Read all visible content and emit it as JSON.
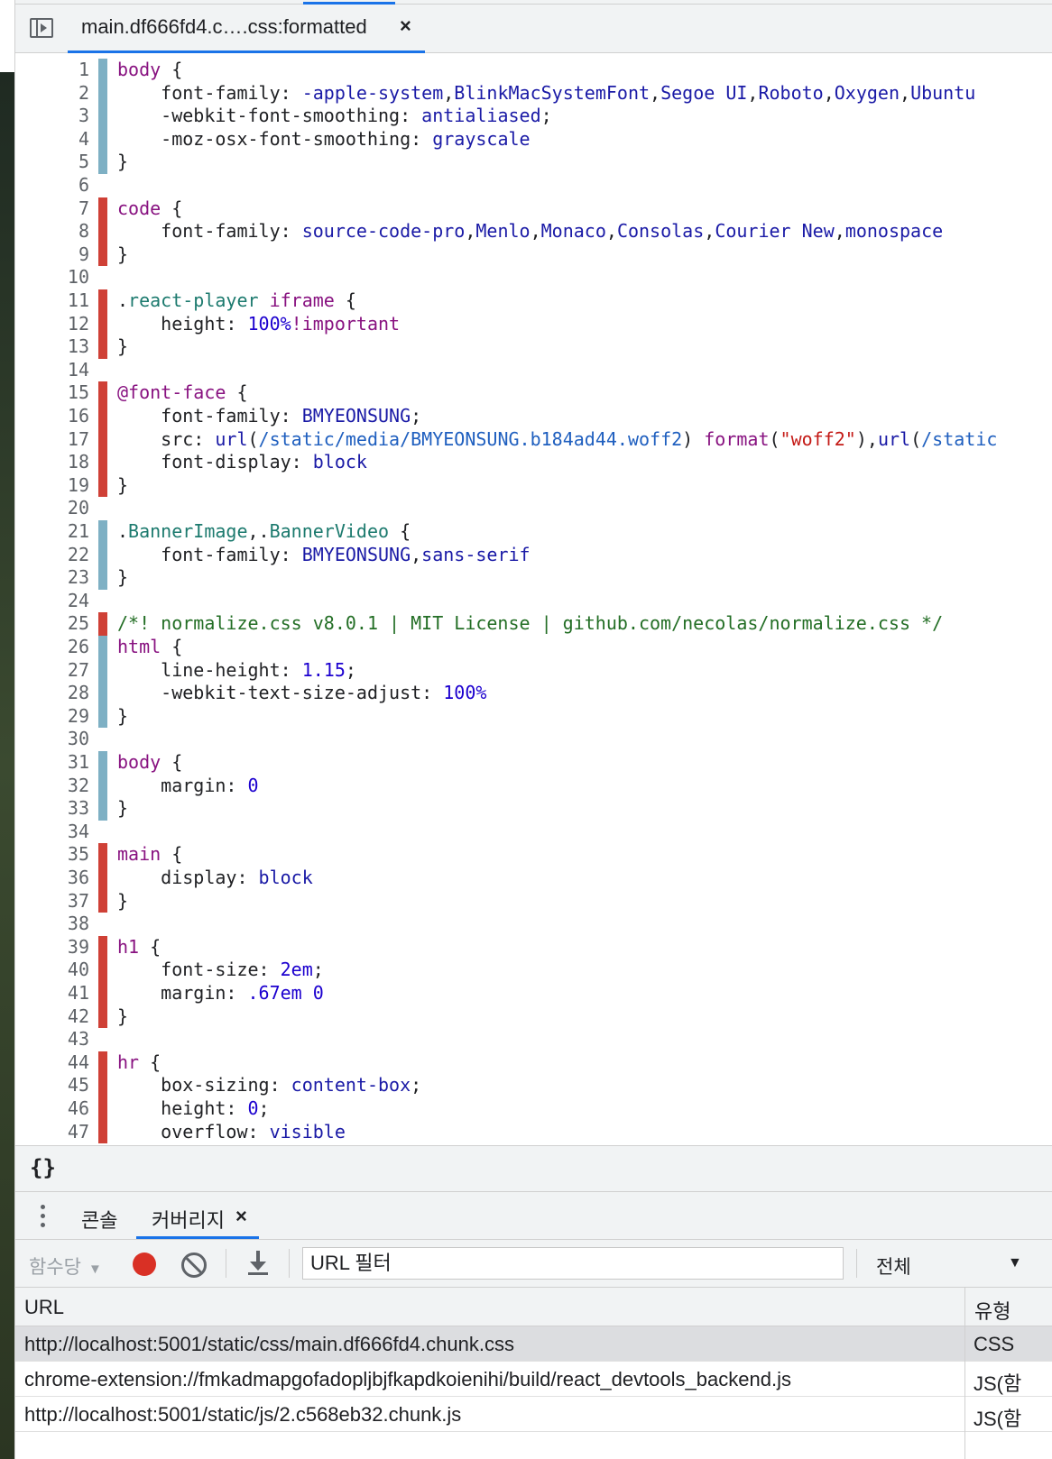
{
  "file_tab": {
    "label": "main.df666fd4.c….css:formatted",
    "close": "×"
  },
  "code_lines": [
    {
      "n": "1",
      "c": "used",
      "t": [
        [
          "sel",
          "body"
        ],
        [
          "p",
          " {"
        ]
      ]
    },
    {
      "n": "2",
      "c": "used",
      "t": [
        [
          "p",
          "    font-family: "
        ],
        [
          "val",
          "-apple-system"
        ],
        [
          "p",
          ","
        ],
        [
          "val",
          "BlinkMacSystemFont"
        ],
        [
          "p",
          ","
        ],
        [
          "val",
          "Segoe UI"
        ],
        [
          "p",
          ","
        ],
        [
          "val",
          "Roboto"
        ],
        [
          "p",
          ","
        ],
        [
          "val",
          "Oxygen"
        ],
        [
          "p",
          ","
        ],
        [
          "val",
          "Ubuntu"
        ]
      ]
    },
    {
      "n": "3",
      "c": "used",
      "t": [
        [
          "p",
          "    -webkit-font-smoothing: "
        ],
        [
          "val",
          "antialiased"
        ],
        [
          "p",
          ";"
        ]
      ]
    },
    {
      "n": "4",
      "c": "used",
      "t": [
        [
          "p",
          "    -moz-osx-font-smoothing: "
        ],
        [
          "val",
          "grayscale"
        ]
      ]
    },
    {
      "n": "5",
      "c": "used",
      "t": [
        [
          "p",
          "}"
        ]
      ]
    },
    {
      "n": "6",
      "c": "",
      "t": []
    },
    {
      "n": "7",
      "c": "unused",
      "t": [
        [
          "sel",
          "code"
        ],
        [
          "p",
          " {"
        ]
      ]
    },
    {
      "n": "8",
      "c": "unused",
      "t": [
        [
          "p",
          "    font-family: "
        ],
        [
          "val",
          "source-code-pro"
        ],
        [
          "p",
          ","
        ],
        [
          "val",
          "Menlo"
        ],
        [
          "p",
          ","
        ],
        [
          "val",
          "Monaco"
        ],
        [
          "p",
          ","
        ],
        [
          "val",
          "Consolas"
        ],
        [
          "p",
          ","
        ],
        [
          "val",
          "Courier New"
        ],
        [
          "p",
          ","
        ],
        [
          "val",
          "monospace"
        ]
      ]
    },
    {
      "n": "9",
      "c": "unused",
      "t": [
        [
          "p",
          "}"
        ]
      ]
    },
    {
      "n": "10",
      "c": "",
      "t": []
    },
    {
      "n": "11",
      "c": "unused",
      "t": [
        [
          "p",
          "."
        ],
        [
          "cls",
          "react-player"
        ],
        [
          "p",
          " "
        ],
        [
          "sel",
          "iframe"
        ],
        [
          "p",
          " {"
        ]
      ]
    },
    {
      "n": "12",
      "c": "unused",
      "t": [
        [
          "p",
          "    height: "
        ],
        [
          "num",
          "100%"
        ],
        [
          "at",
          "!important"
        ]
      ]
    },
    {
      "n": "13",
      "c": "unused",
      "t": [
        [
          "p",
          "}"
        ]
      ]
    },
    {
      "n": "14",
      "c": "",
      "t": []
    },
    {
      "n": "15",
      "c": "unused",
      "t": [
        [
          "at",
          "@font-face"
        ],
        [
          "p",
          " {"
        ]
      ]
    },
    {
      "n": "16",
      "c": "unused",
      "t": [
        [
          "p",
          "    font-family: "
        ],
        [
          "val",
          "BMYEONSUNG"
        ],
        [
          "p",
          ";"
        ]
      ]
    },
    {
      "n": "17",
      "c": "unused",
      "t": [
        [
          "p",
          "    src: "
        ],
        [
          "val",
          "url"
        ],
        [
          "p",
          "("
        ],
        [
          "url",
          "/static/media/BMYEONSUNG.b184ad44.woff2"
        ],
        [
          "p",
          ") "
        ],
        [
          "fn",
          "format"
        ],
        [
          "p",
          "("
        ],
        [
          "str",
          "\"woff2\""
        ],
        [
          "p",
          "),"
        ],
        [
          "val",
          "url"
        ],
        [
          "p",
          "("
        ],
        [
          "url",
          "/static"
        ]
      ]
    },
    {
      "n": "18",
      "c": "unused",
      "t": [
        [
          "p",
          "    font-display: "
        ],
        [
          "val",
          "block"
        ]
      ]
    },
    {
      "n": "19",
      "c": "unused",
      "t": [
        [
          "p",
          "}"
        ]
      ]
    },
    {
      "n": "20",
      "c": "",
      "t": []
    },
    {
      "n": "21",
      "c": "used",
      "t": [
        [
          "p",
          "."
        ],
        [
          "cls",
          "BannerImage"
        ],
        [
          "p",
          ",."
        ],
        [
          "cls",
          "BannerVideo"
        ],
        [
          "p",
          " {"
        ]
      ]
    },
    {
      "n": "22",
      "c": "used",
      "t": [
        [
          "p",
          "    font-family: "
        ],
        [
          "val",
          "BMYEONSUNG"
        ],
        [
          "p",
          ","
        ],
        [
          "val",
          "sans-serif"
        ]
      ]
    },
    {
      "n": "23",
      "c": "used",
      "t": [
        [
          "p",
          "}"
        ]
      ]
    },
    {
      "n": "24",
      "c": "",
      "t": []
    },
    {
      "n": "25",
      "c": "unused",
      "t": [
        [
          "cmt",
          "/*! normalize.css v8.0.1 | MIT License | github.com/necolas/normalize.css */"
        ]
      ]
    },
    {
      "n": "26",
      "c": "used",
      "t": [
        [
          "sel",
          "html"
        ],
        [
          "p",
          " {"
        ]
      ]
    },
    {
      "n": "27",
      "c": "used",
      "t": [
        [
          "p",
          "    line-height: "
        ],
        [
          "num",
          "1.15"
        ],
        [
          "p",
          ";"
        ]
      ]
    },
    {
      "n": "28",
      "c": "used",
      "t": [
        [
          "p",
          "    -webkit-text-size-adjust: "
        ],
        [
          "num",
          "100%"
        ]
      ]
    },
    {
      "n": "29",
      "c": "used",
      "t": [
        [
          "p",
          "}"
        ]
      ]
    },
    {
      "n": "30",
      "c": "",
      "t": []
    },
    {
      "n": "31",
      "c": "used",
      "t": [
        [
          "sel",
          "body"
        ],
        [
          "p",
          " {"
        ]
      ]
    },
    {
      "n": "32",
      "c": "used",
      "t": [
        [
          "p",
          "    margin: "
        ],
        [
          "num",
          "0"
        ]
      ]
    },
    {
      "n": "33",
      "c": "used",
      "t": [
        [
          "p",
          "}"
        ]
      ]
    },
    {
      "n": "34",
      "c": "",
      "t": []
    },
    {
      "n": "35",
      "c": "unused",
      "t": [
        [
          "sel",
          "main"
        ],
        [
          "p",
          " {"
        ]
      ]
    },
    {
      "n": "36",
      "c": "unused",
      "t": [
        [
          "p",
          "    display: "
        ],
        [
          "val",
          "block"
        ]
      ]
    },
    {
      "n": "37",
      "c": "unused",
      "t": [
        [
          "p",
          "}"
        ]
      ]
    },
    {
      "n": "38",
      "c": "",
      "t": []
    },
    {
      "n": "39",
      "c": "unused",
      "t": [
        [
          "sel",
          "h1"
        ],
        [
          "p",
          " {"
        ]
      ]
    },
    {
      "n": "40",
      "c": "unused",
      "t": [
        [
          "p",
          "    font-size: "
        ],
        [
          "num",
          "2em"
        ],
        [
          "p",
          ";"
        ]
      ]
    },
    {
      "n": "41",
      "c": "unused",
      "t": [
        [
          "p",
          "    margin: "
        ],
        [
          "num",
          ".67em"
        ],
        [
          "p",
          " "
        ],
        [
          "num",
          "0"
        ]
      ]
    },
    {
      "n": "42",
      "c": "unused",
      "t": [
        [
          "p",
          "}"
        ]
      ]
    },
    {
      "n": "43",
      "c": "",
      "t": []
    },
    {
      "n": "44",
      "c": "unused",
      "t": [
        [
          "sel",
          "hr"
        ],
        [
          "p",
          " {"
        ]
      ]
    },
    {
      "n": "45",
      "c": "unused",
      "t": [
        [
          "p",
          "    box-sizing: "
        ],
        [
          "val",
          "content-box"
        ],
        [
          "p",
          ";"
        ]
      ]
    },
    {
      "n": "46",
      "c": "unused",
      "t": [
        [
          "p",
          "    height: "
        ],
        [
          "num",
          "0"
        ],
        [
          "p",
          ";"
        ]
      ]
    },
    {
      "n": "47",
      "c": "unused",
      "t": [
        [
          "p",
          "    overflow: "
        ],
        [
          "val",
          "visible"
        ]
      ]
    }
  ],
  "status_bar": {
    "pretty_print": "{}"
  },
  "drawer": {
    "tabs": [
      {
        "label": "콘솔"
      },
      {
        "label": "커버리지",
        "close": "×"
      }
    ]
  },
  "coverage_toolbar": {
    "per_function": "함수당",
    "url_filter_placeholder": "URL 필터",
    "type_filter": "전체"
  },
  "coverage_table": {
    "headers": {
      "url": "URL",
      "type": "유형"
    },
    "rows": [
      {
        "url": "http://localhost:5001/static/css/main.df666fd4.chunk.css",
        "type": "CSS"
      },
      {
        "url": "chrome-extension://fmkadmapgofadopljbjfkapdkoienihi/build/react_devtools_backend.js",
        "type": "JS(함"
      },
      {
        "url": "http://localhost:5001/static/js/2.c568eb32.chunk.js",
        "type": "JS(함"
      }
    ]
  },
  "colors": {
    "used": "#7eb0c4",
    "unused": "#cf4036",
    "accent": "#1a73e8",
    "record": "#d93025"
  }
}
